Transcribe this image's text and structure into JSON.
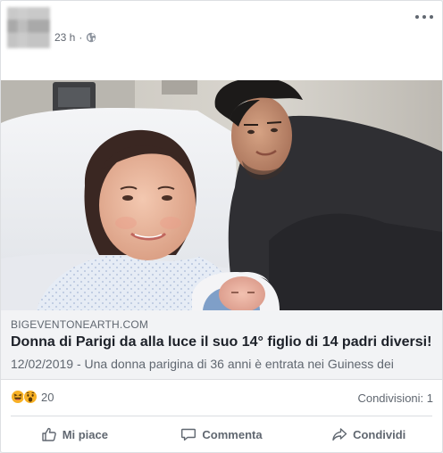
{
  "post": {
    "timestamp": "23 h",
    "separator": "·",
    "privacy_icon": "globe-icon",
    "more_icon": "more-options-icon"
  },
  "link": {
    "domain": "BIGEVENTONEARTH.COM",
    "headline": "Donna di Parigi da alla luce il suo 14° figlio di 14 padri diversi!",
    "summary": "12/02/2019 - Una donna parigina di 36 anni è entrata nei Guiness dei"
  },
  "reactions": {
    "icons": [
      "haha-icon",
      "wow-icon"
    ],
    "count": "20",
    "shares": "Condivisioni: 1"
  },
  "actions": {
    "like": "Mi piace",
    "comment": "Commenta",
    "share": "Condividi"
  },
  "colors": {
    "background": "#e9ebee",
    "card": "#ffffff",
    "link_box": "#f2f3f5",
    "text_primary": "#1d2129",
    "text_secondary": "#606770",
    "reaction_yellow": "#f7b125"
  }
}
